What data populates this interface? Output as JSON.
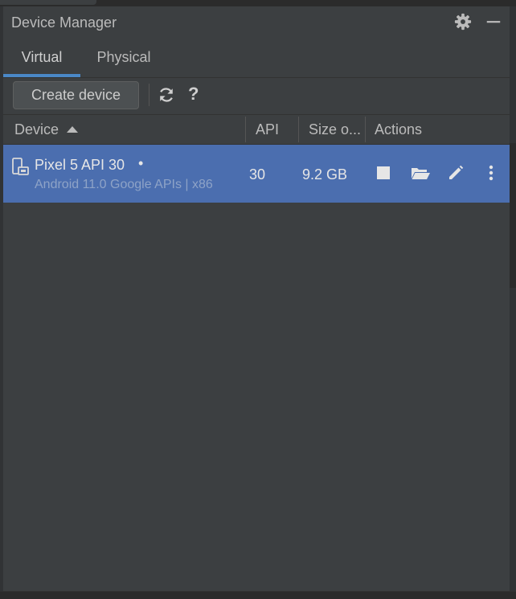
{
  "window": {
    "title": "Device Manager"
  },
  "tabs": [
    {
      "label": "Virtual",
      "active": true
    },
    {
      "label": "Physical",
      "active": false
    }
  ],
  "toolbar": {
    "create_label": "Create device",
    "refresh_icon": "refresh-icon",
    "help_label": "?"
  },
  "table": {
    "columns": [
      "Device",
      "API",
      "Size o...",
      "Actions"
    ],
    "sort": {
      "column": "Device",
      "direction": "ascending"
    },
    "rows": [
      {
        "name": "Pixel 5 API 30",
        "status_dot": "•",
        "subtitle": "Android 11.0 Google APIs | x86",
        "api": "30",
        "size": "9.2 GB",
        "actions": [
          "stop-icon",
          "folder-open-icon",
          "edit-icon",
          "more-vertical-icon"
        ],
        "selected": true
      }
    ]
  },
  "colors": {
    "background": "#3c3f41",
    "selection": "#4b6eaf",
    "accent_tab": "#4a88c7",
    "text": "#bbbbbb"
  }
}
